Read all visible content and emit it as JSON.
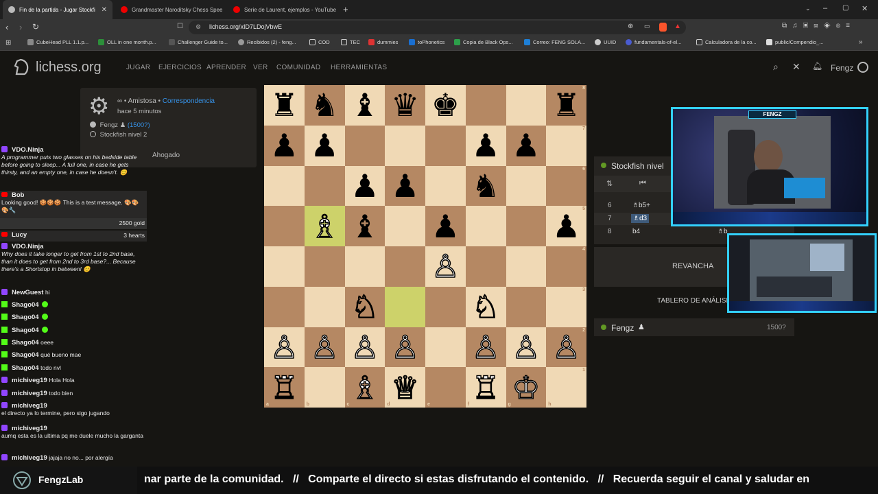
{
  "browser": {
    "tabs": [
      {
        "title": "Fin de la partida - Jugar Stockfi",
        "active": true
      },
      {
        "title": "Grandmaster Naroditsky Chess Spee"
      },
      {
        "title": "Serie de Laurent, ejemplos - YouTube"
      }
    ],
    "url": "lichess.org/xID7LDojVbwE",
    "bookmarks": [
      "CubeHead PLL 1.1.p...",
      "OLL in one month.p...",
      "Challenger Guide to...",
      "Recibidos (2) - feng...",
      "COD",
      "TEC",
      "dummies",
      "toPhonetics",
      "Copia de Black Ops...",
      "Correo: FENG SOLA...",
      "UUID",
      "fundamentals-of-el...",
      "Calculadora de la co...",
      "public/Compendio_..."
    ]
  },
  "lichess": {
    "logo": "lichess.org",
    "nav": [
      "JUGAR",
      "EJERCICIOS",
      "APRENDER",
      "VER",
      "COMUNIDAD",
      "HERRAMIENTAS"
    ],
    "username": "Fengz"
  },
  "game_info": {
    "mode_prefix": "∞ • Amistosa •",
    "mode_link": "Correspondencia",
    "time_ago": "hace 5 minutos",
    "player_white": "Fengz",
    "player_white_rating": "(1500?)",
    "player_black": "Stockfish nivel 2",
    "result": "Ahogado"
  },
  "board": {
    "ranks": [
      "8",
      "7",
      "6",
      "5",
      "4",
      "3",
      "2",
      "1"
    ],
    "files": [
      "a",
      "b",
      "c",
      "d",
      "e",
      "f",
      "g",
      "h"
    ],
    "rows": [
      [
        "♜",
        "♞",
        "♝",
        "♛",
        "♚",
        "",
        "",
        "♜"
      ],
      [
        "♟",
        "♟",
        "",
        "",
        "",
        "♟",
        "♟",
        ""
      ],
      [
        "",
        "",
        "♟",
        "♟",
        "",
        "♞",
        "",
        ""
      ],
      [
        "",
        "♗",
        "♝",
        "",
        "♟",
        "",
        "",
        "♟"
      ],
      [
        "",
        "",
        "",
        "",
        "♙",
        "",
        "",
        ""
      ],
      [
        "",
        "",
        "♘",
        "",
        "",
        "♘",
        "",
        ""
      ],
      [
        "♙",
        "♙",
        "♙",
        "♙",
        "",
        "♙",
        "♙",
        "♙"
      ],
      [
        "♖",
        "",
        "♗",
        "♕",
        "",
        "♖",
        "♔",
        ""
      ]
    ],
    "highlight": [
      "b5",
      "d3"
    ]
  },
  "right_panel": {
    "opponent": "Stockfish nivel",
    "moves": [
      {
        "num": "6",
        "white": "♗b5+"
      },
      {
        "num": "7",
        "white": "♗d3"
      },
      {
        "num": "8",
        "white": "b4",
        "black": "♗b"
      }
    ],
    "rematch": "REVANCHA",
    "analysis": "TABLERO DE ANÁLISI",
    "me": "Fengz",
    "me_rating": "1500?"
  },
  "webcam": {
    "name": "FENGZ"
  },
  "chat": [
    {
      "src": "tw",
      "user": "VDO.Ninja",
      "text": "A programmer puts two glasses on his bedside table before going to sleep... A full one, in case he gets thirsty, and an empty one, in case he doesn't. 😊"
    },
    {
      "src": "yt",
      "user": "Bob",
      "text": "Looking good! 🍪🍪🍪 This is a test message. 🎨🎨🎨🔧"
    },
    {
      "src": "yt",
      "user": "",
      "text": "2500 gold"
    },
    {
      "src": "yt",
      "user": "Lucy",
      "text": "3 hearts"
    },
    {
      "src": "tw",
      "user": "VDO.Ninja",
      "text": "Why does it take longer to get from 1st to 2nd base, than it does to get from 2nd to 3rd base?... Because there's a Shortstop in between! 😊"
    },
    {
      "src": "tw",
      "user": "NewGuest",
      "text": "hi"
    },
    {
      "src": "kk",
      "user": "Shago04",
      "text": ""
    },
    {
      "src": "kk",
      "user": "Shago04",
      "text": ""
    },
    {
      "src": "kk",
      "user": "Shago04",
      "text": ""
    },
    {
      "src": "kk",
      "user": "Shago04",
      "text": "oeee"
    },
    {
      "src": "kk",
      "user": "Shago04",
      "text": "qué bueno mae"
    },
    {
      "src": "kk",
      "user": "Shago04",
      "text": "todo nvl"
    },
    {
      "src": "tw",
      "user": "michiveg19",
      "text": "Hola Hola"
    },
    {
      "src": "tw",
      "user": "michiveg19",
      "text": "todo bien"
    },
    {
      "src": "tw",
      "user": "michiveg19",
      "text": "el directo ya lo termine, pero sigo jugando"
    },
    {
      "src": "tw",
      "user": "michiveg19",
      "text": "aumq esta es la ultima pq me duele mucho la garganta"
    },
    {
      "src": "tw",
      "user": "michiveg19",
      "text": "jajaja no no... por alergía"
    }
  ],
  "ticker": {
    "brand": "FengzLab",
    "text": "nar parte de la comunidad.   //   Comparte el directo si estas disfrutando el contenido.   //   Recuerda seguir el canal y saludar en"
  },
  "colors": {
    "accent": "#33d1ff",
    "lichess_blue": "#3692e7",
    "board_light": "#f0d9b5",
    "board_dark": "#b58863",
    "online_green": "#629924"
  }
}
